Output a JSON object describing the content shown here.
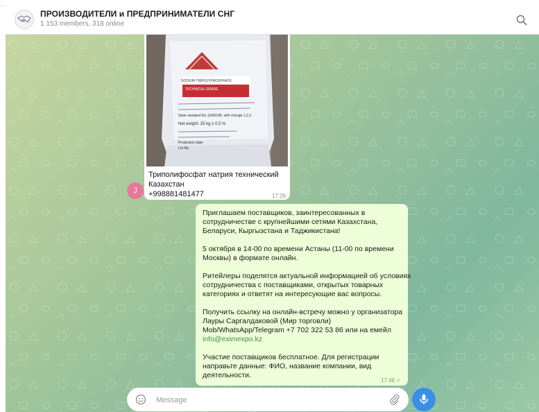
{
  "header": {
    "title": "ПРОИЗВОДИТЕЛИ и ПРЕДПРИНИМАТЕЛИ СНГ",
    "subtitle": "1 153 members, 318 online",
    "avatar_icon": "handshake-icon",
    "search_icon": "search-icon"
  },
  "photo_message": {
    "bag_text": [
      "SODIUM TRIPOLYPHOSPHATE",
      "TECHNICAL GRADE",
      "State standard No.13493-86, with change 1,2,3",
      "Net weight: 25 kg ± 0,5 %",
      "Production date:",
      "Lot No."
    ],
    "caption_lines": [
      "Триполифосфат натрия технический",
      "Казахстан",
      "+998881481477"
    ],
    "time": "17:26",
    "sender_initial": "J"
  },
  "text_message": {
    "lines": [
      "Приглашаем поставщиков, заинтересованных в",
      "сотрудничестве с крупнейшими сетями Казахстана,",
      "Беларуси, Кыргызстана и Таджикистана!",
      "",
      "5 октября в 14-00 по времени Астаны (11-00 по времени",
      "Москвы) в формате онлайн.",
      "",
      "Ритейлеры поделятся актуальной информацией об условиях",
      "сотрудничества с поставщиками, открытых товарных",
      "категориях и ответят на интересующие вас вопросы.",
      "",
      "Получить ссылку на онлайн-встречу можно у организатора",
      "Лауры Саргалдаковой (Мир торговли)",
      "Mob/WhatsApp/Telegram +7 702 322 53 86 или на емейл",
      "info@eximexpo.kz",
      "",
      "Участие поставщиков бесплатное. Для регистрации",
      "направьте данные: ФИО, название компании, вид",
      "деятельности."
    ],
    "time": "17:48 ✓"
  },
  "composer": {
    "placeholder": "Message",
    "emoji_icon": "emoji-icon",
    "attach_icon": "paperclip-icon",
    "mic_icon": "microphone-icon"
  },
  "colors": {
    "accent": "#3a8ee6",
    "outgoing_bubble": "#eefed8",
    "link": "#3c8d4c",
    "avatar": "#e8779a"
  }
}
